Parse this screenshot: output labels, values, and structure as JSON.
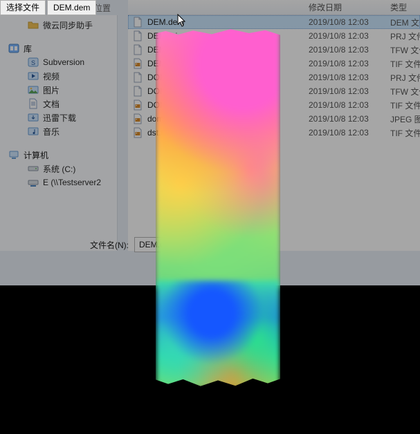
{
  "top": {
    "choose_btn": "选择文件",
    "current_file": "DEM.dem",
    "ghost": "位置"
  },
  "headers": {
    "date": "修改日期",
    "type": "类型"
  },
  "tree": {
    "section_fav": {
      "items": [
        {
          "label": "微云同步助手",
          "icon": "folder"
        }
      ]
    },
    "section_lib": {
      "label": "库",
      "icon": "library",
      "items": [
        {
          "label": "Subversion",
          "icon": "subversion"
        },
        {
          "label": "视频",
          "icon": "video"
        },
        {
          "label": "图片",
          "icon": "picture"
        },
        {
          "label": "文档",
          "icon": "document"
        },
        {
          "label": "迅雷下载",
          "icon": "download"
        },
        {
          "label": "音乐",
          "icon": "music"
        }
      ]
    },
    "section_comp": {
      "label": "计算机",
      "icon": "computer",
      "items": [
        {
          "label": "系统 (C:)",
          "icon": "drive"
        },
        {
          "label": "E (\\\\Testserver2",
          "icon": "netdrive"
        }
      ]
    }
  },
  "files": [
    {
      "name": "DEM.dem",
      "icon": "generic",
      "date": "2019/10/8 12:03",
      "type": "DEM 文件",
      "selected": true
    },
    {
      "name": "DEM.prj",
      "icon": "generic",
      "date": "2019/10/8 12:03",
      "type": "PRJ 文件"
    },
    {
      "name": "DEM.tfw",
      "icon": "generic",
      "date": "2019/10/8 12:03",
      "type": "TFW 文件"
    },
    {
      "name": "DEM.tif",
      "icon": "image",
      "date": "2019/10/8 12:03",
      "type": "TIF 文件"
    },
    {
      "name": "DOM.prj",
      "icon": "generic",
      "date": "2019/10/8 12:03",
      "type": "PRJ 文件"
    },
    {
      "name": "DOM.tfw",
      "icon": "generic",
      "date": "2019/10/8 12:03",
      "type": "TFW 文件"
    },
    {
      "name": "DOM.tif",
      "icon": "image",
      "date": "2019/10/8 12:03",
      "type": "TIF 文件"
    },
    {
      "name": "dom3_Level_19.jpg",
      "icon": "image",
      "date": "2019/10/8 12:03",
      "type": "JPEG 图像"
    },
    {
      "name": "dst.tif",
      "icon": "image",
      "date": "2019/10/8 12:03",
      "type": "TIF 文件"
    }
  ],
  "filename": {
    "label": "文件名(N):",
    "value": "DEM.dem"
  }
}
